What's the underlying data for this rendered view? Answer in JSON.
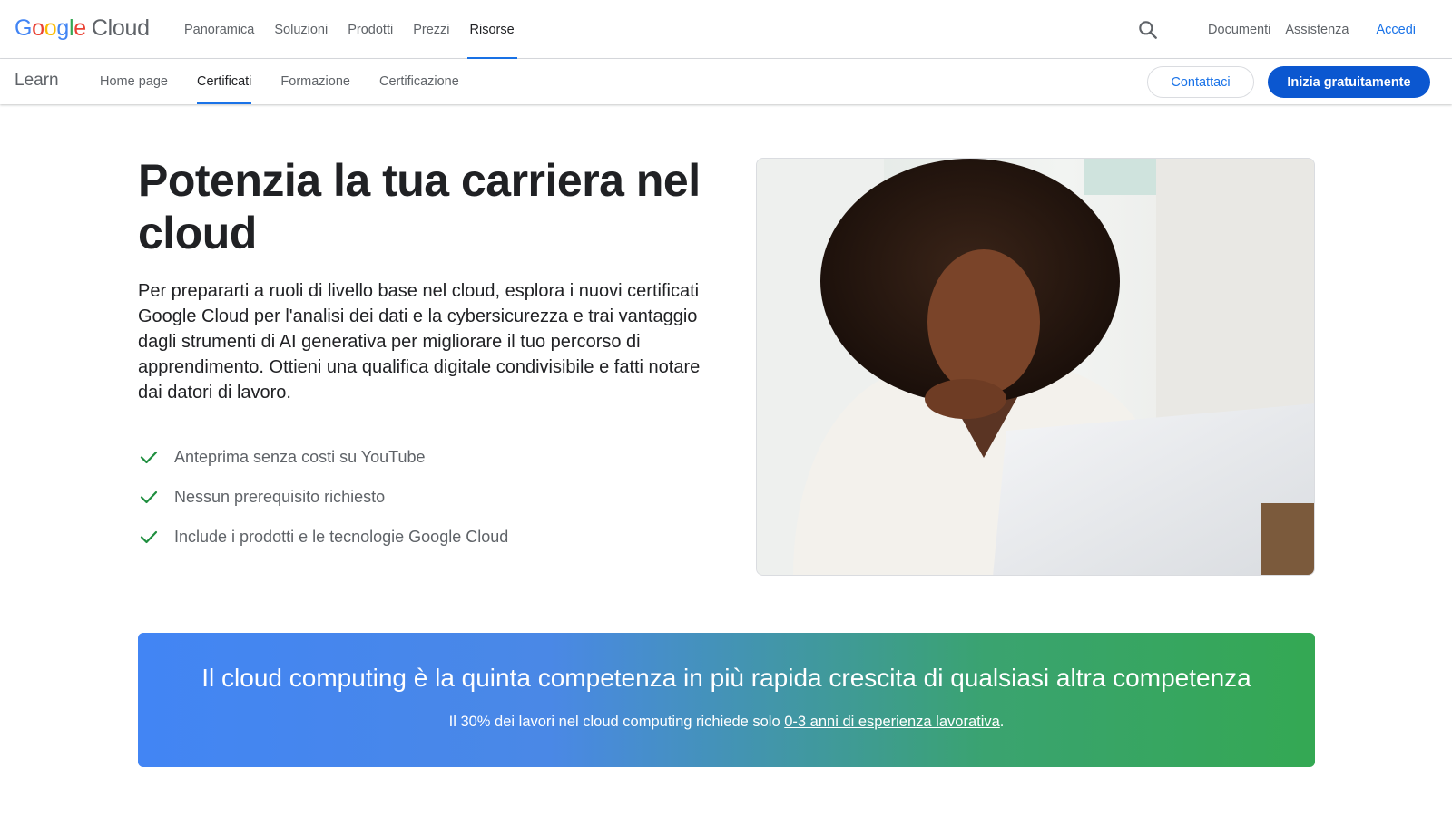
{
  "header": {
    "logo": {
      "g1": "G",
      "g2": "o",
      "g3": "o",
      "g4": "g",
      "g5": "l",
      "g6": "e",
      "cloud": "Cloud"
    },
    "nav": [
      {
        "label": "Panoramica"
      },
      {
        "label": "Soluzioni"
      },
      {
        "label": "Prodotti"
      },
      {
        "label": "Prezzi"
      },
      {
        "label": "Risorse",
        "active": true
      }
    ],
    "search_icon": "search-icon",
    "right_links": {
      "docs": "Documenti",
      "support": "Assistenza",
      "signin": "Accedi"
    }
  },
  "subheader": {
    "section": "Learn",
    "tabs": [
      {
        "label": "Home page"
      },
      {
        "label": "Certificati",
        "active": true
      },
      {
        "label": "Formazione"
      },
      {
        "label": "Certificazione"
      }
    ],
    "contact_label": "Contattaci",
    "start_label": "Inizia gratuitamente"
  },
  "hero": {
    "title": "Potenzia la tua carriera nel cloud",
    "description": "Per prepararti a ruoli di livello base nel cloud, esplora i nuovi certificati Google Cloud per l'analisi dei dati e la cybersicurezza e trai vantaggio dagli strumenti di AI generativa per migliorare il tuo percorso di apprendimento. Ottieni una qualifica digitale condivisibile e fatti notare dai datori di lavoro.",
    "checklist": [
      "Anteprima senza costi su YouTube",
      "Nessun prerequisito richiesto",
      "Include i prodotti e le tecnologie Google Cloud"
    ],
    "check_icon": "check-icon",
    "check_color": "#1e8e3e"
  },
  "banner": {
    "title": "Il cloud computing è la quinta competenza in più rapida crescita di qualsiasi altra competenza",
    "sub_prefix": "Il 30% dei lavori nel cloud computing richiede solo ",
    "sub_link": "0-3 anni di esperienza lavorativa",
    "sub_suffix": "."
  },
  "colors": {
    "accent": "#1a73e8",
    "primary_button": "#0b57d0",
    "gradient_start": "#4285f4",
    "gradient_end": "#34a853"
  }
}
